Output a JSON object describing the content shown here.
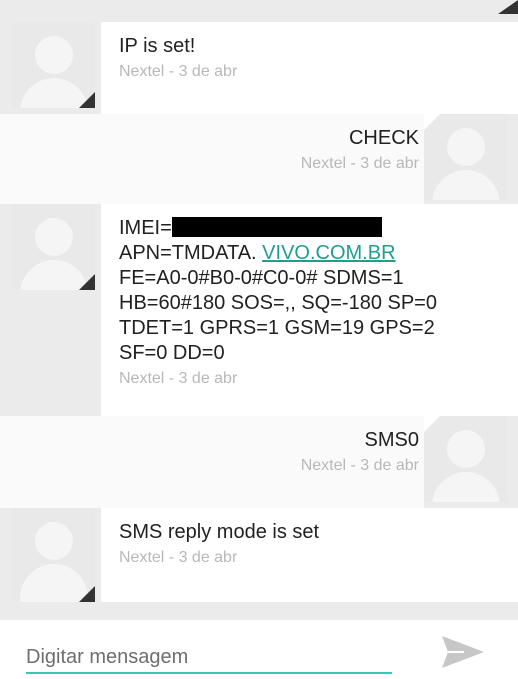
{
  "thread": {
    "messages": [
      {
        "direction": "in",
        "text": "IP is set!",
        "meta": "Nextel - 3 de abr"
      },
      {
        "direction": "out",
        "text": "CHECK",
        "meta": "Nextel - 3 de abr"
      },
      {
        "direction": "in",
        "imei_label": "IMEI=",
        "apn_prefix": "APN=TMDATA. ",
        "apn_link": "VIVO.COM.BR",
        "body_rest": "FE=A0-0#B0-0#C0-0# SDMS=1\nHB=60#180 SOS=,, SQ=-180 SP=0\nTDET=1 GPRS=1 GSM=19 GPS=2\nSF=0 DD=0",
        "meta": "Nextel - 3 de abr"
      },
      {
        "direction": "out",
        "text": "SMS0",
        "meta": "Nextel - 3 de abr"
      },
      {
        "direction": "in",
        "text": "SMS reply mode is set",
        "meta": "Nextel - 3 de abr"
      }
    ]
  },
  "composer": {
    "placeholder": "Digitar mensagem",
    "send_icon": "send-icon"
  },
  "colors": {
    "background": "#ebebeb",
    "incoming_bubble": "#ffffff",
    "outgoing_bubble": "#fafafa",
    "link": "#1e9f8e",
    "accent_underline": "#40c4b6",
    "meta_text": "#b8b8b8"
  }
}
